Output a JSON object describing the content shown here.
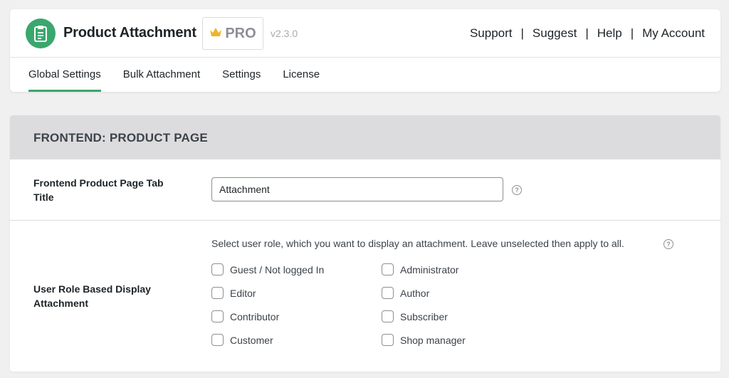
{
  "header": {
    "app_title": "Product Attachment",
    "pro_label": "PRO",
    "version": "v2.3.0",
    "links": [
      "Support",
      "Suggest",
      "Help",
      "My Account"
    ],
    "separator": "|",
    "accent_color": "#3aa76d"
  },
  "tabs": [
    {
      "label": "Global Settings",
      "active": true
    },
    {
      "label": "Bulk Attachment",
      "active": false
    },
    {
      "label": "Settings",
      "active": false
    },
    {
      "label": "License",
      "active": false
    }
  ],
  "section": {
    "title": "FRONTEND: PRODUCT PAGE",
    "tab_title": {
      "label": "Frontend Product Page Tab Title",
      "value": "Attachment",
      "help": "?"
    },
    "user_role": {
      "label": "User Role Based Display Attachment",
      "description": "Select user role, which you want to display an attachment. Leave unselected then apply to all.",
      "help": "?",
      "roles_left": [
        "Guest / Not logged In",
        "Editor",
        "Contributor",
        "Customer"
      ],
      "roles_right": [
        "Administrator",
        "Author",
        "Subscriber",
        "Shop manager"
      ]
    }
  }
}
